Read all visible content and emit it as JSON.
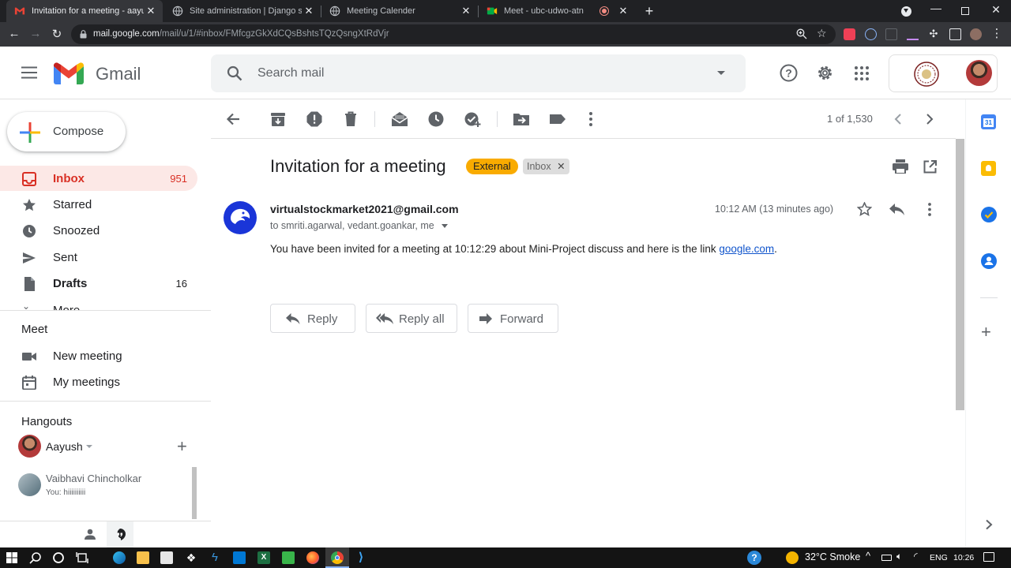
{
  "browser": {
    "tabs": [
      {
        "title": "Invitation for a meeting - aayush",
        "active": true
      },
      {
        "title": "Site administration | Django site",
        "active": false
      },
      {
        "title": "Meeting Calender",
        "active": false
      },
      {
        "title": "Meet - ubc-udwo-atn",
        "active": false
      }
    ],
    "url_host": "mail.google.com",
    "url_path": "/mail/u/1/#inbox/FMfcgzGkXdCQsBshtsTQzQsngXtRdVjr"
  },
  "gmail": {
    "product_name": "Gmail",
    "search_placeholder": "Search mail"
  },
  "sidebar": {
    "compose_label": "Compose",
    "items": [
      {
        "label": "Inbox",
        "count": "951"
      },
      {
        "label": "Starred",
        "count": ""
      },
      {
        "label": "Snoozed",
        "count": ""
      },
      {
        "label": "Sent",
        "count": ""
      },
      {
        "label": "Drafts",
        "count": "16"
      },
      {
        "label": "More",
        "count": ""
      }
    ],
    "meet_title": "Meet",
    "meet_items": [
      "New meeting",
      "My meetings"
    ],
    "hangouts_title": "Hangouts",
    "hangouts_user": "Aayush",
    "contact_name": "Vaibhavi Chincholkar",
    "contact_status": "You: hiiiiiiiiii"
  },
  "toolbar": {
    "page_count": "1 of 1,530"
  },
  "message": {
    "subject": "Invitation for a meeting",
    "label_external": "External",
    "label_inbox": "Inbox",
    "sender": "virtualstockmarket2021@gmail.com",
    "recipients": "to smriti.agarwal, vedant.goankar, me",
    "time": "10:12 AM (13 minutes ago)",
    "body_text": "You have been invited for a meeting at 10:12:29 about Mini-Project discuss and here is the link ",
    "body_link": "google.com",
    "body_end": "."
  },
  "actions": {
    "reply": "Reply",
    "reply_all": "Reply all",
    "forward": "Forward"
  },
  "taskbar": {
    "weather": "32°C  Smoke",
    "lang": "ENG",
    "clock": "10:26"
  },
  "colors": {
    "accent_red": "#d93025",
    "inbox_highlight": "#fce8e6",
    "external_chip": "#f9ab00",
    "link_blue": "#1155cc"
  }
}
